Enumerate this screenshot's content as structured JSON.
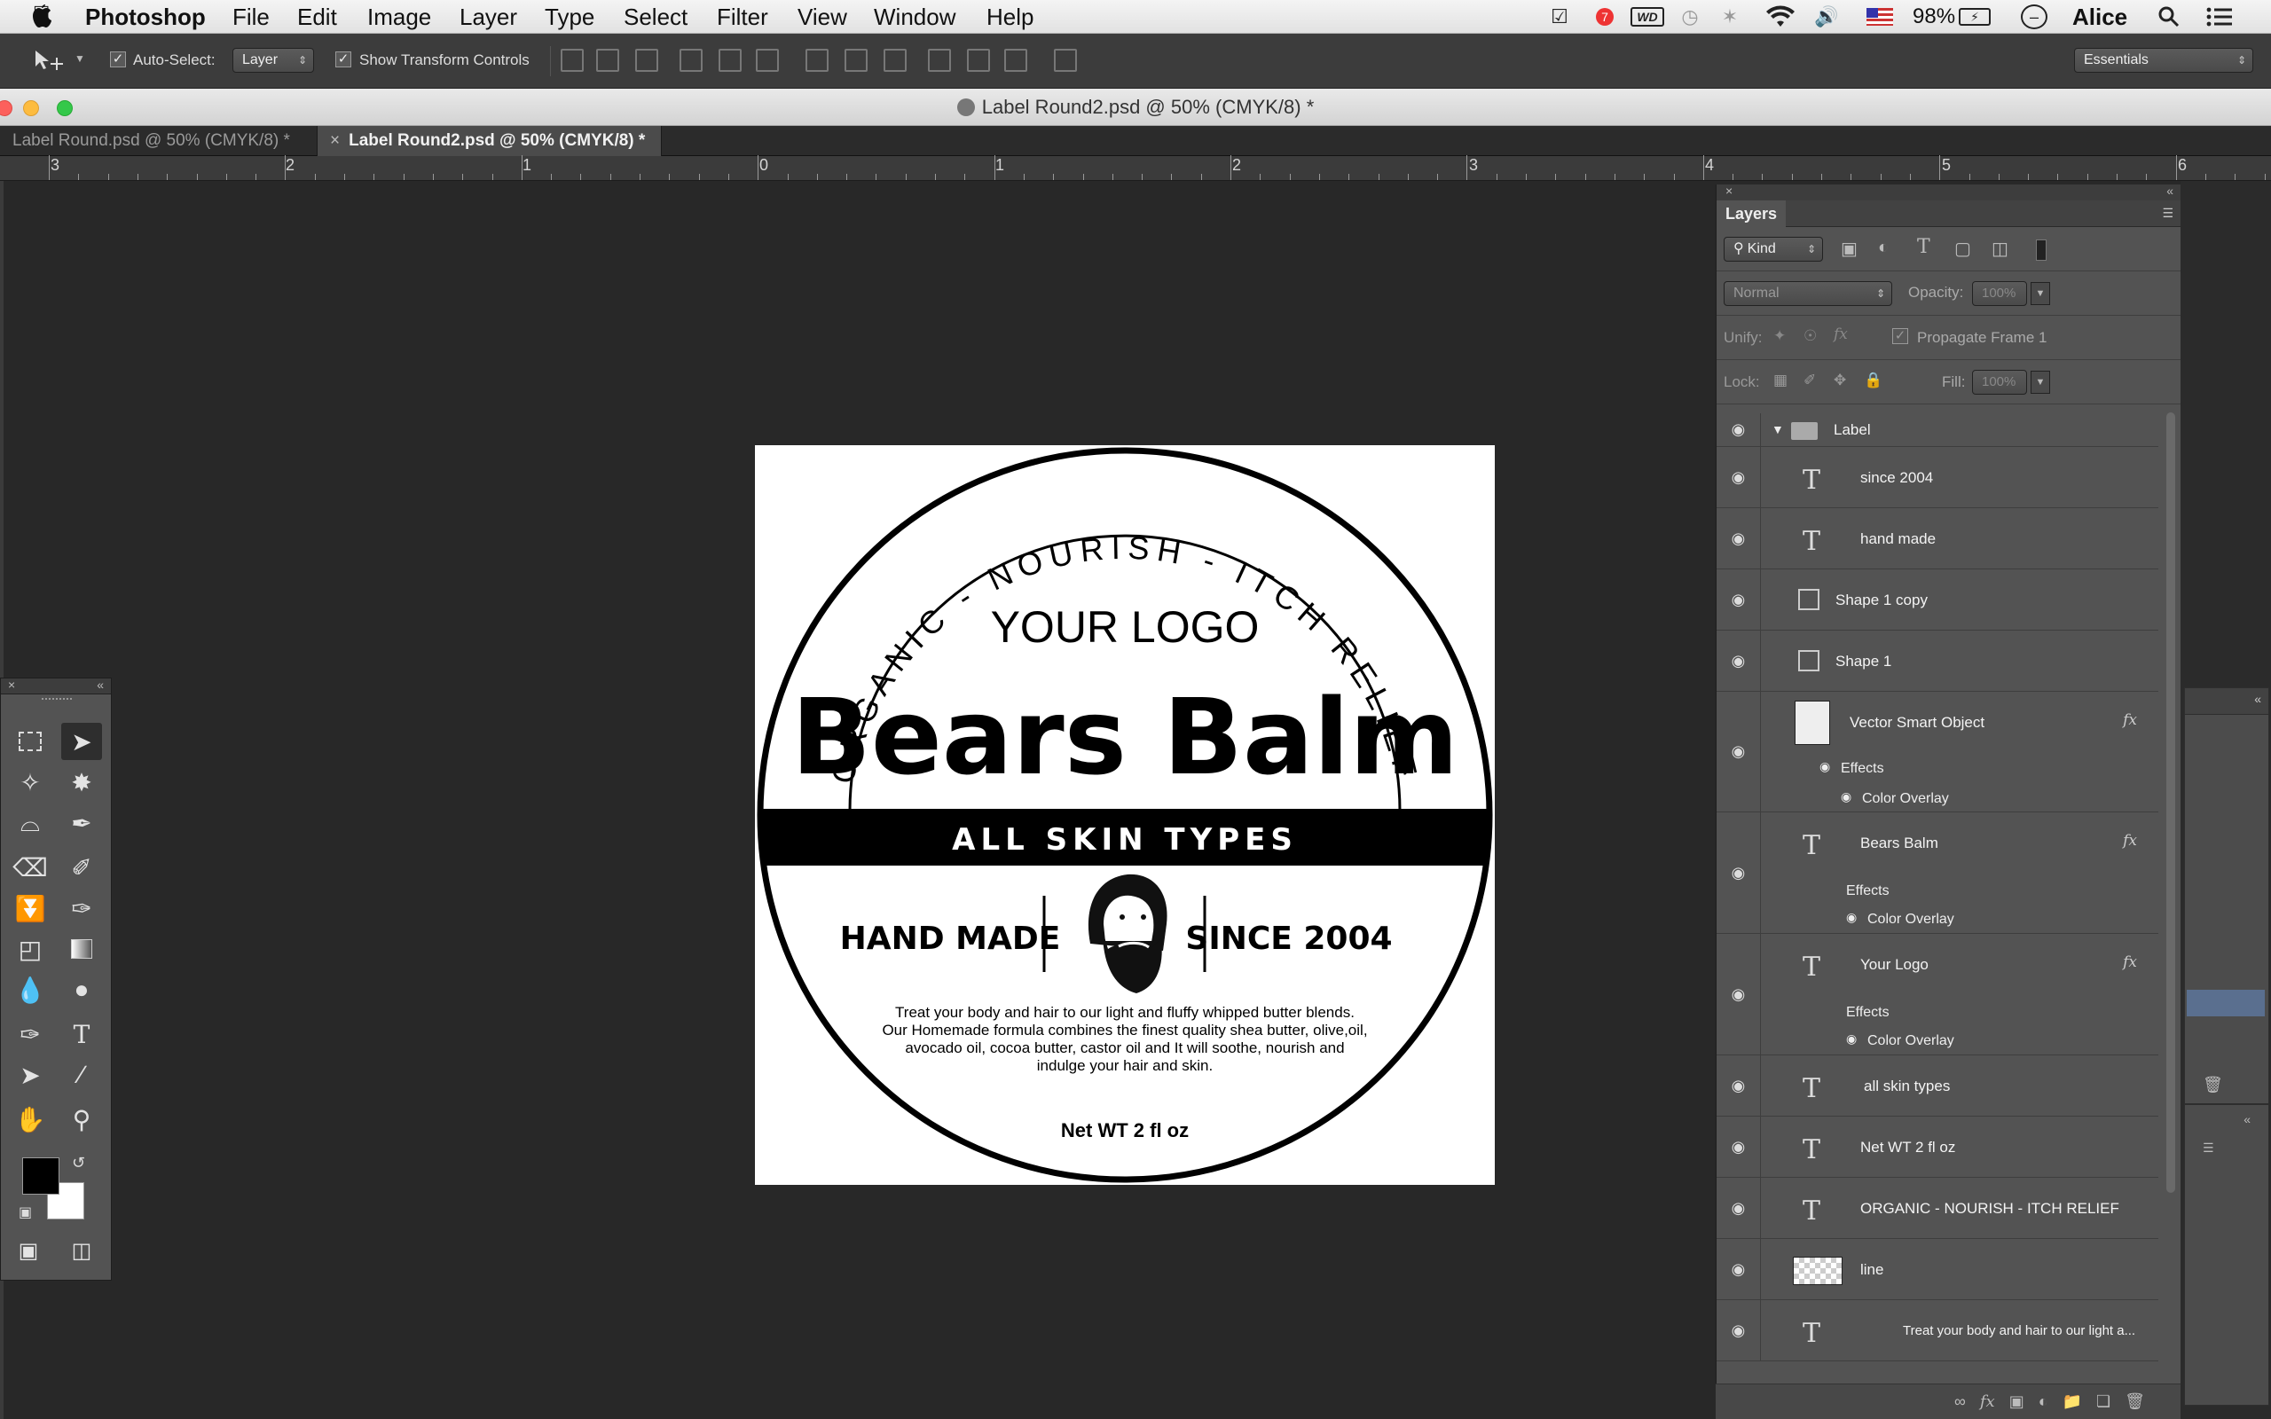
{
  "menubar": {
    "app": "Photoshop",
    "items": [
      "File",
      "Edit",
      "Image",
      "Layer",
      "Type",
      "Select",
      "Filter",
      "View",
      "Window",
      "Help"
    ],
    "battery": "98%",
    "user": "Alice",
    "notif_badge": "7"
  },
  "options": {
    "auto_select_label": "Auto-Select:",
    "auto_select_value": "Layer",
    "transform_label": "Show Transform Controls",
    "workspace": "Essentials"
  },
  "window": {
    "title": "Label Round2.psd @ 50% (CMYK/8) *",
    "tabs": [
      {
        "label": "Label Round.psd @ 50% (CMYK/8) *"
      },
      {
        "label": "Label Round2.psd @ 50% (CMYK/8) *"
      }
    ]
  },
  "ruler": {
    "labels": [
      "3",
      "2",
      "1",
      "0",
      "1",
      "2",
      "3",
      "4",
      "5",
      "6"
    ]
  },
  "label_art": {
    "arc_text": "ORGANIC - NOURISH - ITCH RELIEF",
    "logo": "YOUR LOGO",
    "brand": "Bears Balm",
    "band": "ALL SKIN TYPES",
    "left": "HAND MADE",
    "right": "SINCE 2004",
    "desc": [
      "Treat your body and hair to our light and fluffy whipped butter blends.",
      "Our Homemade formula combines the finest quality shea butter, olive,oil,",
      "avocado oil, cocoa butter, castor oil and It will soothe, nourish and",
      "indulge your hair and skin."
    ],
    "net": "Net WT 2 fl oz"
  },
  "layers": {
    "tab": "Layers",
    "kind": "Kind",
    "blend": "Normal",
    "opacity_label": "Opacity:",
    "opacity": "100%",
    "unify_label": "Unify:",
    "propagate": "Propagate Frame 1",
    "lock_label": "Lock:",
    "fill_label": "Fill:",
    "fill": "100%",
    "group": "Label",
    "effects": "Effects",
    "color_overlay": "Color Overlay",
    "fx": "fx",
    "rows": {
      "since": "since 2004",
      "handmade": "hand made",
      "shape1copy": "Shape 1 copy",
      "shape1": "Shape 1",
      "vso": "Vector Smart Object",
      "bears": "Bears Balm",
      "yourlogo": "Your Logo",
      "allskin": "all skin types",
      "netwt": "Net WT 2 fl oz",
      "organic": "ORGANIC - NOURISH - ITCH RELIEF",
      "line": "line",
      "treat": "Treat your body and hair to our light a..."
    }
  },
  "colors": {
    "canvas_bg": "#282828",
    "panel": "#535353",
    "label_bg": "#ffffff"
  }
}
